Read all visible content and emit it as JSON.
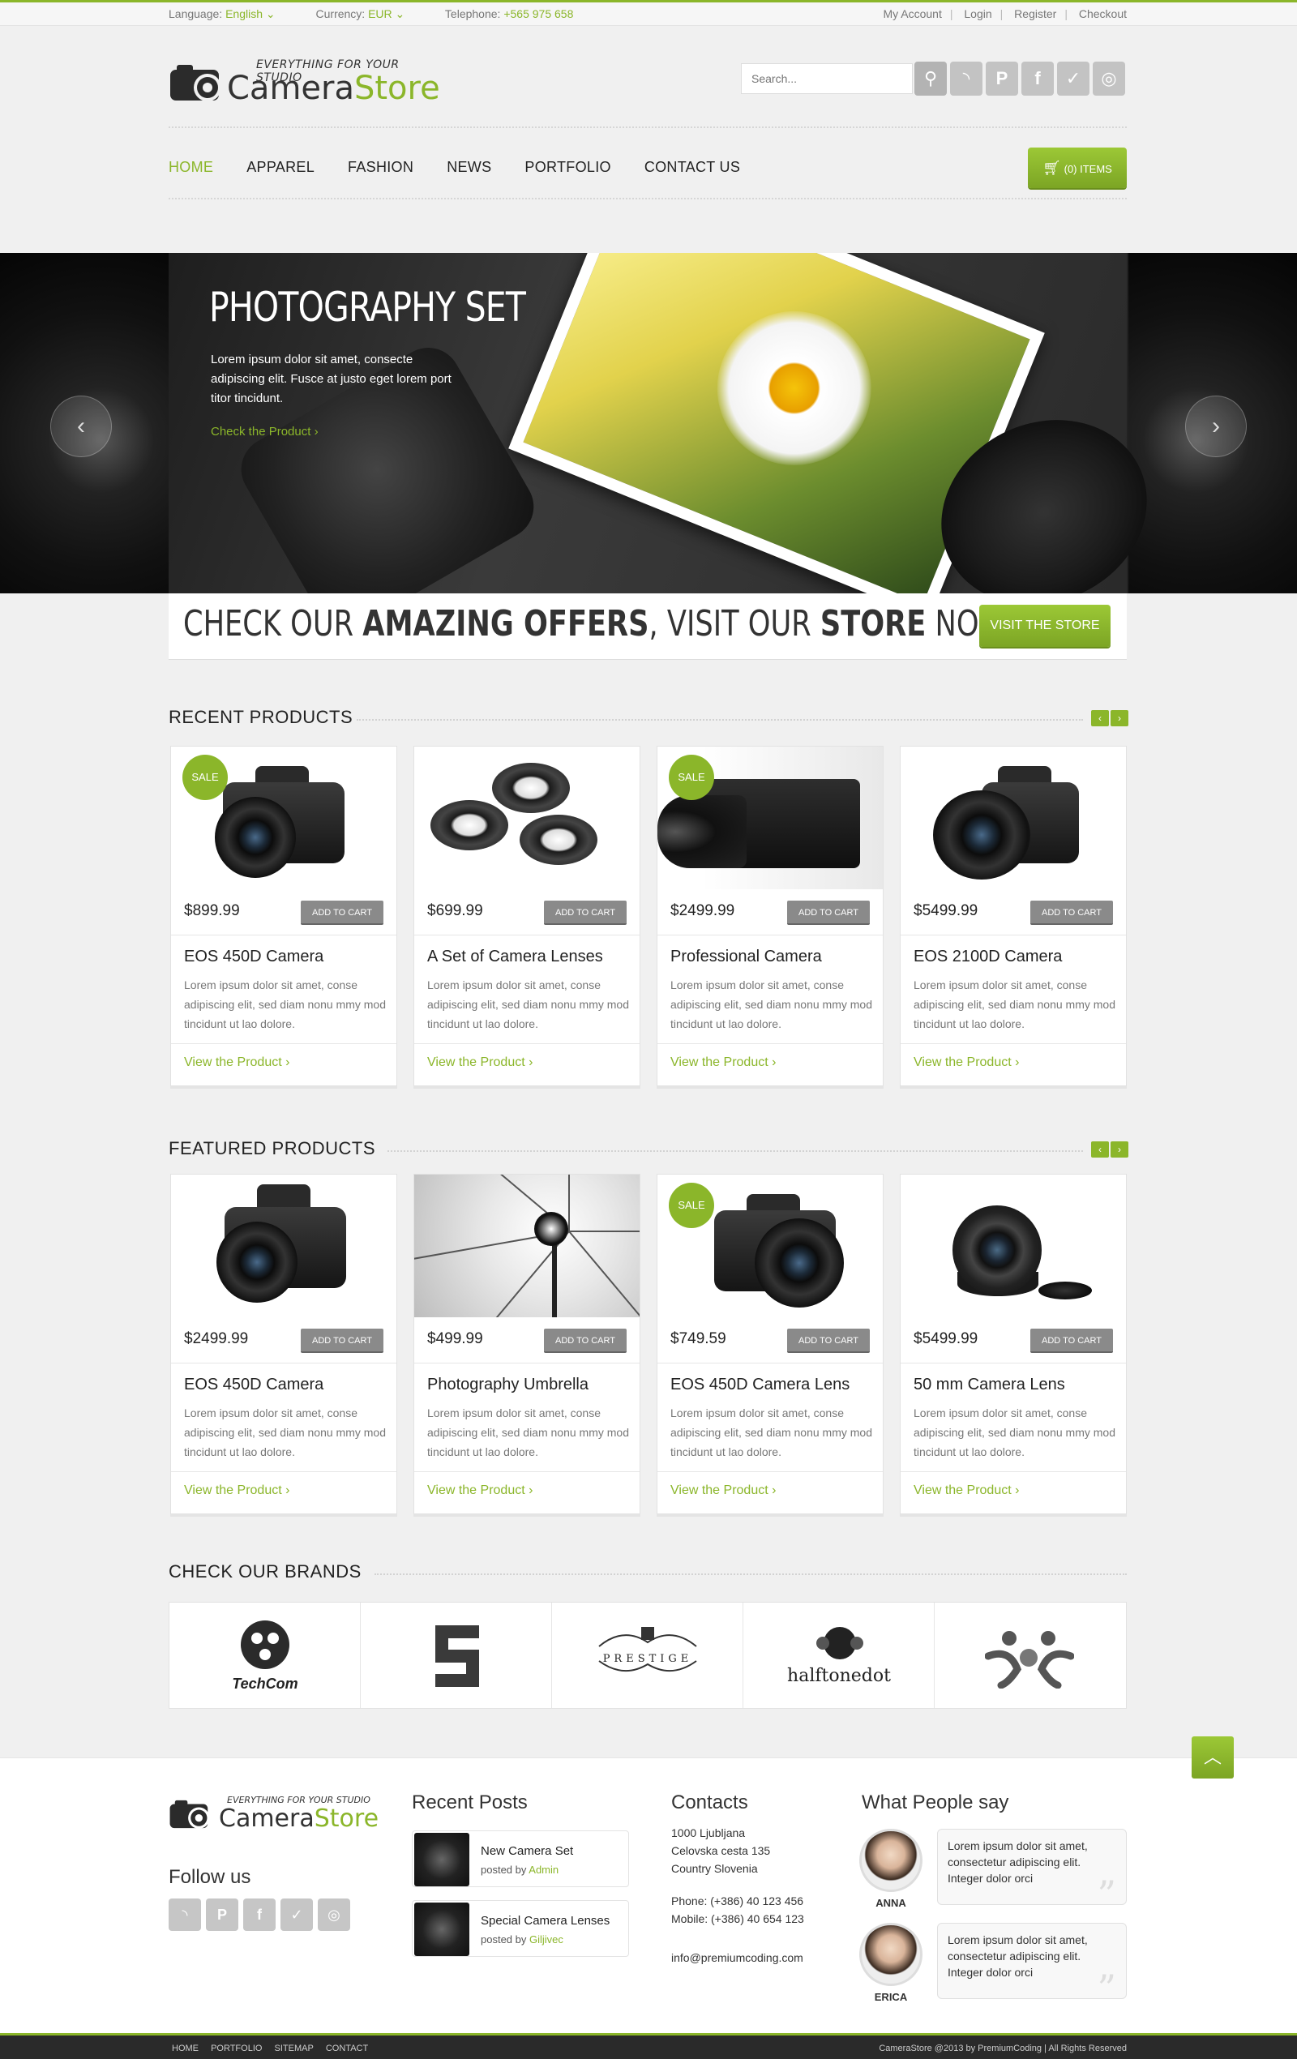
{
  "topbar": {
    "language_label": "Language:",
    "language_value": "English",
    "currency_label": "Currency:",
    "currency_value": "EUR",
    "telephone_label": "Telephone:",
    "telephone_value": "+565 975 658",
    "links": [
      "My Account",
      "Login",
      "Register",
      "Checkout"
    ]
  },
  "header": {
    "tagline": "EVERYTHING FOR YOUR STUDIO",
    "logo_first": "Camera",
    "logo_second": "Store",
    "search_placeholder": "Search...",
    "cart_label": "(0) ITEMS"
  },
  "nav": [
    "HOME",
    "APPAREL",
    "FASHION",
    "NEWS",
    "PORTFOLIO",
    "CONTACT US"
  ],
  "slider": {
    "title": "PHOTOGRAPHY SET",
    "text": "Lorem ipsum dolor sit amet, consecte adipiscing elit. Fusce at justo eget lorem port titor tincidunt.",
    "link": "Check the Product ›"
  },
  "offers": {
    "part1": "CHECK OUR ",
    "part2": "AMAZING OFFERS",
    "part3": ", VISIT OUR ",
    "part4": "STORE",
    "part5": " NOW",
    "button": "VISIT THE STORE"
  },
  "recent": {
    "title": "RECENT PRODUCTS",
    "products": [
      {
        "price": "$899.99",
        "name": "EOS 450D Camera",
        "sale": "SALE"
      },
      {
        "price": "$699.99",
        "name": "A Set of Camera Lenses",
        "sale": ""
      },
      {
        "price": "$2499.99",
        "name": "Professional Camera",
        "sale": "SALE"
      },
      {
        "price": "$5499.99",
        "name": "EOS 2100D Camera",
        "sale": ""
      }
    ]
  },
  "featured": {
    "title": "FEATURED PRODUCTS",
    "products": [
      {
        "price": "$2499.99",
        "name": "EOS 450D Camera",
        "sale": ""
      },
      {
        "price": "$499.99",
        "name": "Photography Umbrella",
        "sale": ""
      },
      {
        "price": "$749.59",
        "name": "EOS 450D Camera Lens",
        "sale": "SALE"
      },
      {
        "price": "$5499.99",
        "name": "50 mm Camera Lens",
        "sale": ""
      }
    ]
  },
  "product_common": {
    "add_to_cart": "ADD TO CART",
    "description": "Lorem ipsum dolor sit amet, conse adipiscing elit, sed diam nonu mmy mod tincidunt ut lao dolore.",
    "view": "View the Product ›"
  },
  "brands": {
    "title": "CHECK OUR BRANDS",
    "items": [
      "TechCom",
      "",
      "PRESTIGE",
      "halftonedot",
      ""
    ]
  },
  "footer": {
    "follow_title": "Follow us",
    "posts_title": "Recent Posts",
    "posts": [
      {
        "title": "New Camera Set",
        "by": "posted by ",
        "author": "Admin"
      },
      {
        "title": "Special Camera Lenses",
        "by": "posted by ",
        "author": "Giljivec"
      }
    ],
    "contacts_title": "Contacts",
    "address": [
      "1000 Ljubljana",
      "Celovska cesta 135",
      "Country Slovenia"
    ],
    "phone": "Phone: (+386) 40 123 456",
    "mobile": "Mobile: (+386) 40 654 123",
    "email": "info@premiumcoding.com",
    "people_title": "What People say",
    "testimonials": [
      {
        "name": "ANNA",
        "text": "Lorem ipsum dolor sit amet, consectetur adipiscing elit. Integer dolor orci"
      },
      {
        "name": "ERICA",
        "text": "Lorem ipsum dolor sit amet, consectetur adipiscing elit. Integer dolor orci"
      }
    ]
  },
  "bottom": {
    "links": [
      "HOME",
      "PORTFOLIO",
      "SITEMAP",
      "CONTACT"
    ],
    "copyright": "CameraStore @2013 by PremiumCoding | All Rights Reserved"
  },
  "colors": {
    "accent": "#8bb62a",
    "button_gray": "#8a8a8a",
    "background": "#f0f0f0"
  },
  "icons": [
    "search-icon",
    "rss-icon",
    "pinterest-icon",
    "facebook-icon",
    "twitter-icon",
    "dribbble-icon",
    "cart-icon",
    "chevron-left-icon",
    "chevron-right-icon",
    "arrow-up-icon",
    "quote-icon"
  ]
}
